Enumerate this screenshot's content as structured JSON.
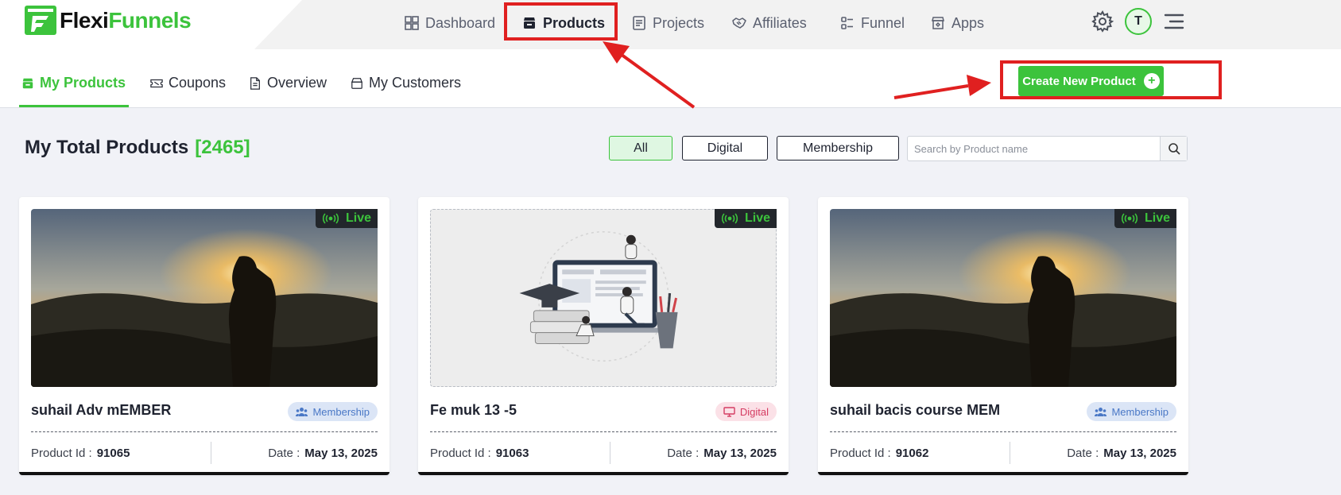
{
  "brand": {
    "name_part1": "Flexi",
    "name_part2": "Funnels",
    "color": "#3cc33c"
  },
  "nav": {
    "items": [
      {
        "label": "Dashboard",
        "icon": "dashboard-icon"
      },
      {
        "label": "Products",
        "icon": "products-box-icon",
        "active": true
      },
      {
        "label": "Projects",
        "icon": "projects-icon"
      },
      {
        "label": "Affiliates",
        "icon": "handshake-icon"
      },
      {
        "label": "Funnel",
        "icon": "funnel-icon"
      },
      {
        "label": "Apps",
        "icon": "apps-store-icon"
      }
    ],
    "avatar_initial": "T"
  },
  "subnav": {
    "tabs": [
      {
        "label": "My Products",
        "icon": "products-box-icon",
        "active": true
      },
      {
        "label": "Coupons",
        "icon": "coupon-ticket-icon"
      },
      {
        "label": "Overview",
        "icon": "document-icon"
      },
      {
        "label": "My Customers",
        "icon": "customers-box-icon"
      }
    ],
    "create_button": "Create New Product"
  },
  "main": {
    "title": "My Total Products",
    "count": "[2465]",
    "filters": [
      "All",
      "Digital",
      "Membership"
    ],
    "active_filter": "All",
    "search_placeholder": "Search by Product name"
  },
  "cards": [
    {
      "status": "Live",
      "name": "suhail Adv mEMBER",
      "type": "Membership",
      "product_id_label": "Product Id :",
      "product_id": "91065",
      "date_label": "Date :",
      "date": "May 13, 2025",
      "thumbnail": "sunset-hiker-photo"
    },
    {
      "status": "Live",
      "name": "Fe muk 13 -5",
      "type": "Digital",
      "product_id_label": "Product Id :",
      "product_id": "91063",
      "date_label": "Date :",
      "date": "May 13, 2025",
      "thumbnail": "online-course-illustration"
    },
    {
      "status": "Live",
      "name": "suhail bacis course MEM",
      "type": "Membership",
      "product_id_label": "Product Id :",
      "product_id": "91062",
      "date_label": "Date :",
      "date": "May 13, 2025",
      "thumbnail": "sunset-hiker-photo"
    }
  ],
  "colors": {
    "accent": "#3cc33c",
    "annotation_red": "#e02020",
    "membership_badge": "#4a78c6",
    "digital_badge": "#d53c62"
  }
}
